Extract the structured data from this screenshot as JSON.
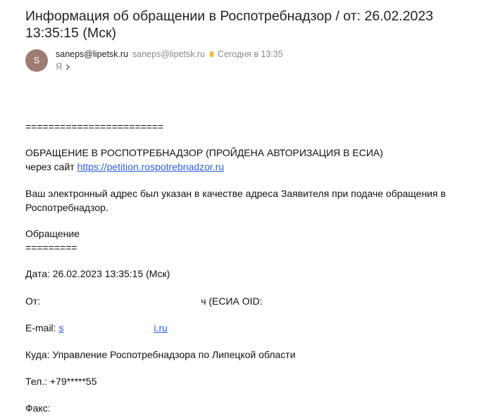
{
  "subject": "Информация об обращении в Роспотребнадзор / от: 26.02.2023 13:35:15 (Мск)",
  "sender": {
    "avatar_letter": "S",
    "name": "saneps@lipetsk.ru",
    "email": "saneps@lipetsk.ru",
    "time": "Сегодня в 13:35",
    "to": "Я",
    "icons": [
      "hand-wave-icon",
      "chevron-right-icon"
    ]
  },
  "body": {
    "separator1": "========================",
    "heading": "ОБРАЩЕНИЕ В РОСПОТРЕБНАДЗОР (ПРОЙДЕНА АВТОРИЗАЦИЯ В ЕСИА)",
    "via_prefix": "через сайт",
    "via_link": "https://petition.rospotrebnadzor.ru",
    "notice_line1": "Ваш электронный адрес был указан в качестве адреса Заявителя при подаче обращения в",
    "notice_line2": "Роспотребнадзор.",
    "appeal_label": "Обращение",
    "separator2": "=========",
    "date_line": "Дата: 26.02.2023 13:35:15 (Мск)",
    "from_label": "От:",
    "from_tail": "ч (ЕСИА OID:",
    "email_label": "E-mail:",
    "email_start": "s",
    "email_end": "i.ru",
    "to_line": "Куда: Управление Роспотребнадзора по Липецкой области",
    "phone_line": "Тел.: +79*****55",
    "fax_label": "Факс:"
  },
  "colors": {
    "link": "#2a5fd6",
    "avatar": "#9c7b73",
    "muted": "#8a8a8a"
  }
}
